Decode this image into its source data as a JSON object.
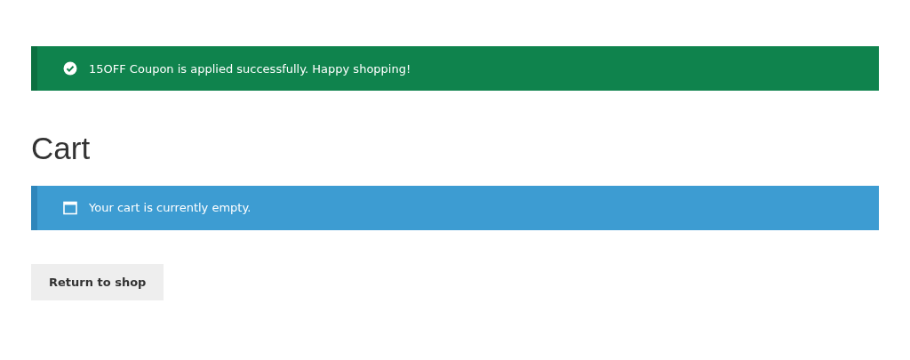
{
  "notices_top": [
    {
      "kind": "success",
      "text": "15OFF Coupon is applied successfully. Happy shopping!"
    }
  ],
  "page_title": "Cart",
  "notices": [
    {
      "kind": "info",
      "text": "Your cart is currently empty."
    }
  ],
  "buttons": [
    {
      "label": "Return to shop"
    }
  ]
}
